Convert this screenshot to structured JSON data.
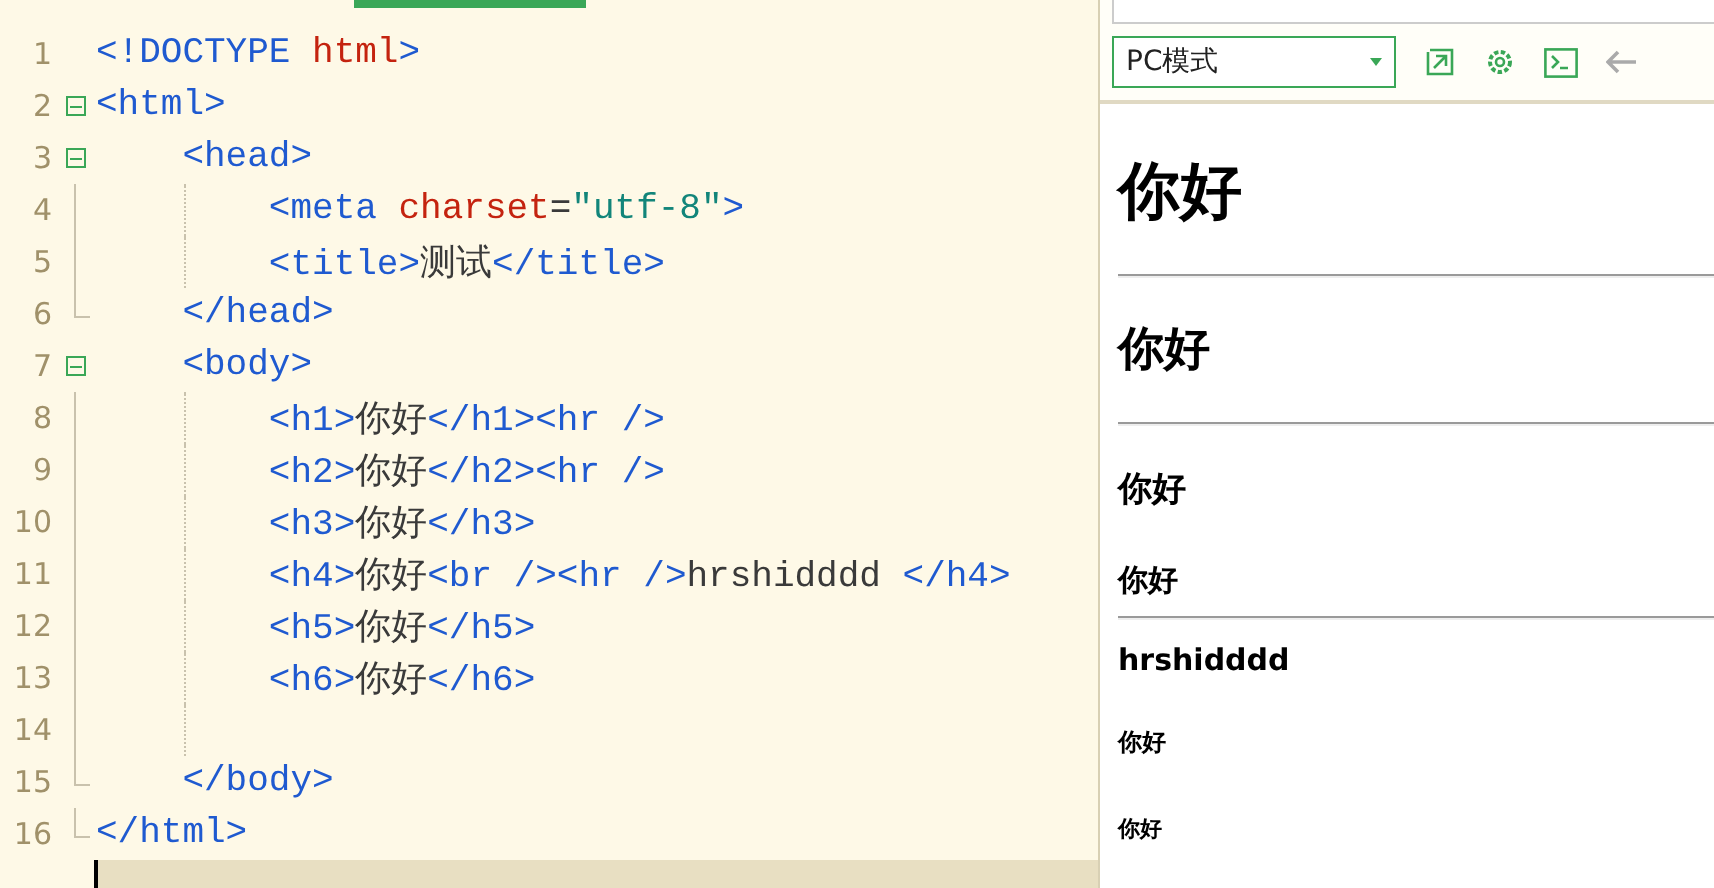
{
  "editor": {
    "lines": [
      {
        "number": "1",
        "fold_toggle": false,
        "fold_end": false,
        "guide": false,
        "tokens": [
          {
            "kind": "tag",
            "text": "<!DOCTYPE "
          },
          {
            "kind": "attr",
            "text": "html"
          },
          {
            "kind": "tag",
            "text": ">"
          }
        ]
      },
      {
        "number": "2",
        "fold_toggle": true,
        "fold_end": false,
        "guide": false,
        "tokens": [
          {
            "kind": "tag",
            "text": "<html>"
          }
        ]
      },
      {
        "number": "3",
        "fold_toggle": true,
        "fold_end": false,
        "guide": false,
        "tokens": [
          {
            "kind": "tag",
            "text": "    <head>"
          }
        ]
      },
      {
        "number": "4",
        "fold_toggle": false,
        "fold_end": false,
        "guide": true,
        "tokens": [
          {
            "kind": "tag",
            "text": "        <meta "
          },
          {
            "kind": "attr",
            "text": "charset"
          },
          {
            "kind": "text",
            "text": "="
          },
          {
            "kind": "string",
            "text": "\"utf-8\""
          },
          {
            "kind": "tag",
            "text": ">"
          }
        ]
      },
      {
        "number": "5",
        "fold_toggle": false,
        "fold_end": false,
        "guide": true,
        "tokens": [
          {
            "kind": "tag",
            "text": "        <title>"
          },
          {
            "kind": "text",
            "text": "测试"
          },
          {
            "kind": "tag",
            "text": "</title>"
          }
        ]
      },
      {
        "number": "6",
        "fold_toggle": false,
        "fold_end": true,
        "guide": false,
        "tokens": [
          {
            "kind": "tag",
            "text": "    </head>"
          }
        ]
      },
      {
        "number": "7",
        "fold_toggle": true,
        "fold_end": false,
        "guide": false,
        "tokens": [
          {
            "kind": "tag",
            "text": "    <body>"
          }
        ]
      },
      {
        "number": "8",
        "fold_toggle": false,
        "fold_end": false,
        "guide": true,
        "tokens": [
          {
            "kind": "tag",
            "text": "        <h1>"
          },
          {
            "kind": "text",
            "text": "你好"
          },
          {
            "kind": "tag",
            "text": "</h1><hr />"
          }
        ]
      },
      {
        "number": "9",
        "fold_toggle": false,
        "fold_end": false,
        "guide": true,
        "tokens": [
          {
            "kind": "tag",
            "text": "        <h2>"
          },
          {
            "kind": "text",
            "text": "你好"
          },
          {
            "kind": "tag",
            "text": "</h2><hr />"
          }
        ]
      },
      {
        "number": "10",
        "fold_toggle": false,
        "fold_end": false,
        "guide": true,
        "tokens": [
          {
            "kind": "tag",
            "text": "        <h3>"
          },
          {
            "kind": "text",
            "text": "你好"
          },
          {
            "kind": "tag",
            "text": "</h3>"
          }
        ]
      },
      {
        "number": "11",
        "fold_toggle": false,
        "fold_end": false,
        "guide": true,
        "tokens": [
          {
            "kind": "tag",
            "text": "        <h4>"
          },
          {
            "kind": "text",
            "text": "你好"
          },
          {
            "kind": "tag",
            "text": "<br /><hr />"
          },
          {
            "kind": "text",
            "text": "hrshidddd "
          },
          {
            "kind": "tag",
            "text": "</h4>"
          }
        ]
      },
      {
        "number": "12",
        "fold_toggle": false,
        "fold_end": false,
        "guide": true,
        "tokens": [
          {
            "kind": "tag",
            "text": "        <h5>"
          },
          {
            "kind": "text",
            "text": "你好"
          },
          {
            "kind": "tag",
            "text": "</h5>"
          }
        ]
      },
      {
        "number": "13",
        "fold_toggle": false,
        "fold_end": false,
        "guide": true,
        "tokens": [
          {
            "kind": "tag",
            "text": "        <h6>"
          },
          {
            "kind": "text",
            "text": "你好"
          },
          {
            "kind": "tag",
            "text": "</h6>"
          }
        ]
      },
      {
        "number": "14",
        "fold_toggle": false,
        "fold_end": false,
        "guide": true
      },
      {
        "number": "15",
        "fold_toggle": false,
        "fold_end": true,
        "guide": false,
        "tokens": [
          {
            "kind": "tag",
            "text": "    </body>"
          }
        ]
      },
      {
        "number": "16",
        "fold_toggle": false,
        "fold_end": true,
        "guide": false,
        "tokens": [
          {
            "kind": "tag",
            "text": "</html>"
          }
        ]
      }
    ]
  },
  "preview": {
    "mode_select": {
      "value": "PC模式"
    },
    "blocks": [
      {
        "kind": "h1",
        "text": "你好"
      },
      {
        "kind": "hr"
      },
      {
        "kind": "h2",
        "text": "你好"
      },
      {
        "kind": "hr"
      },
      {
        "kind": "h3",
        "text": "你好"
      },
      {
        "kind": "h4",
        "text": "你好"
      },
      {
        "kind": "hr"
      },
      {
        "kind": "h4",
        "text": "hrshidddd"
      },
      {
        "kind": "h5",
        "text": "你好"
      },
      {
        "kind": "h6",
        "text": "你好"
      }
    ]
  }
}
